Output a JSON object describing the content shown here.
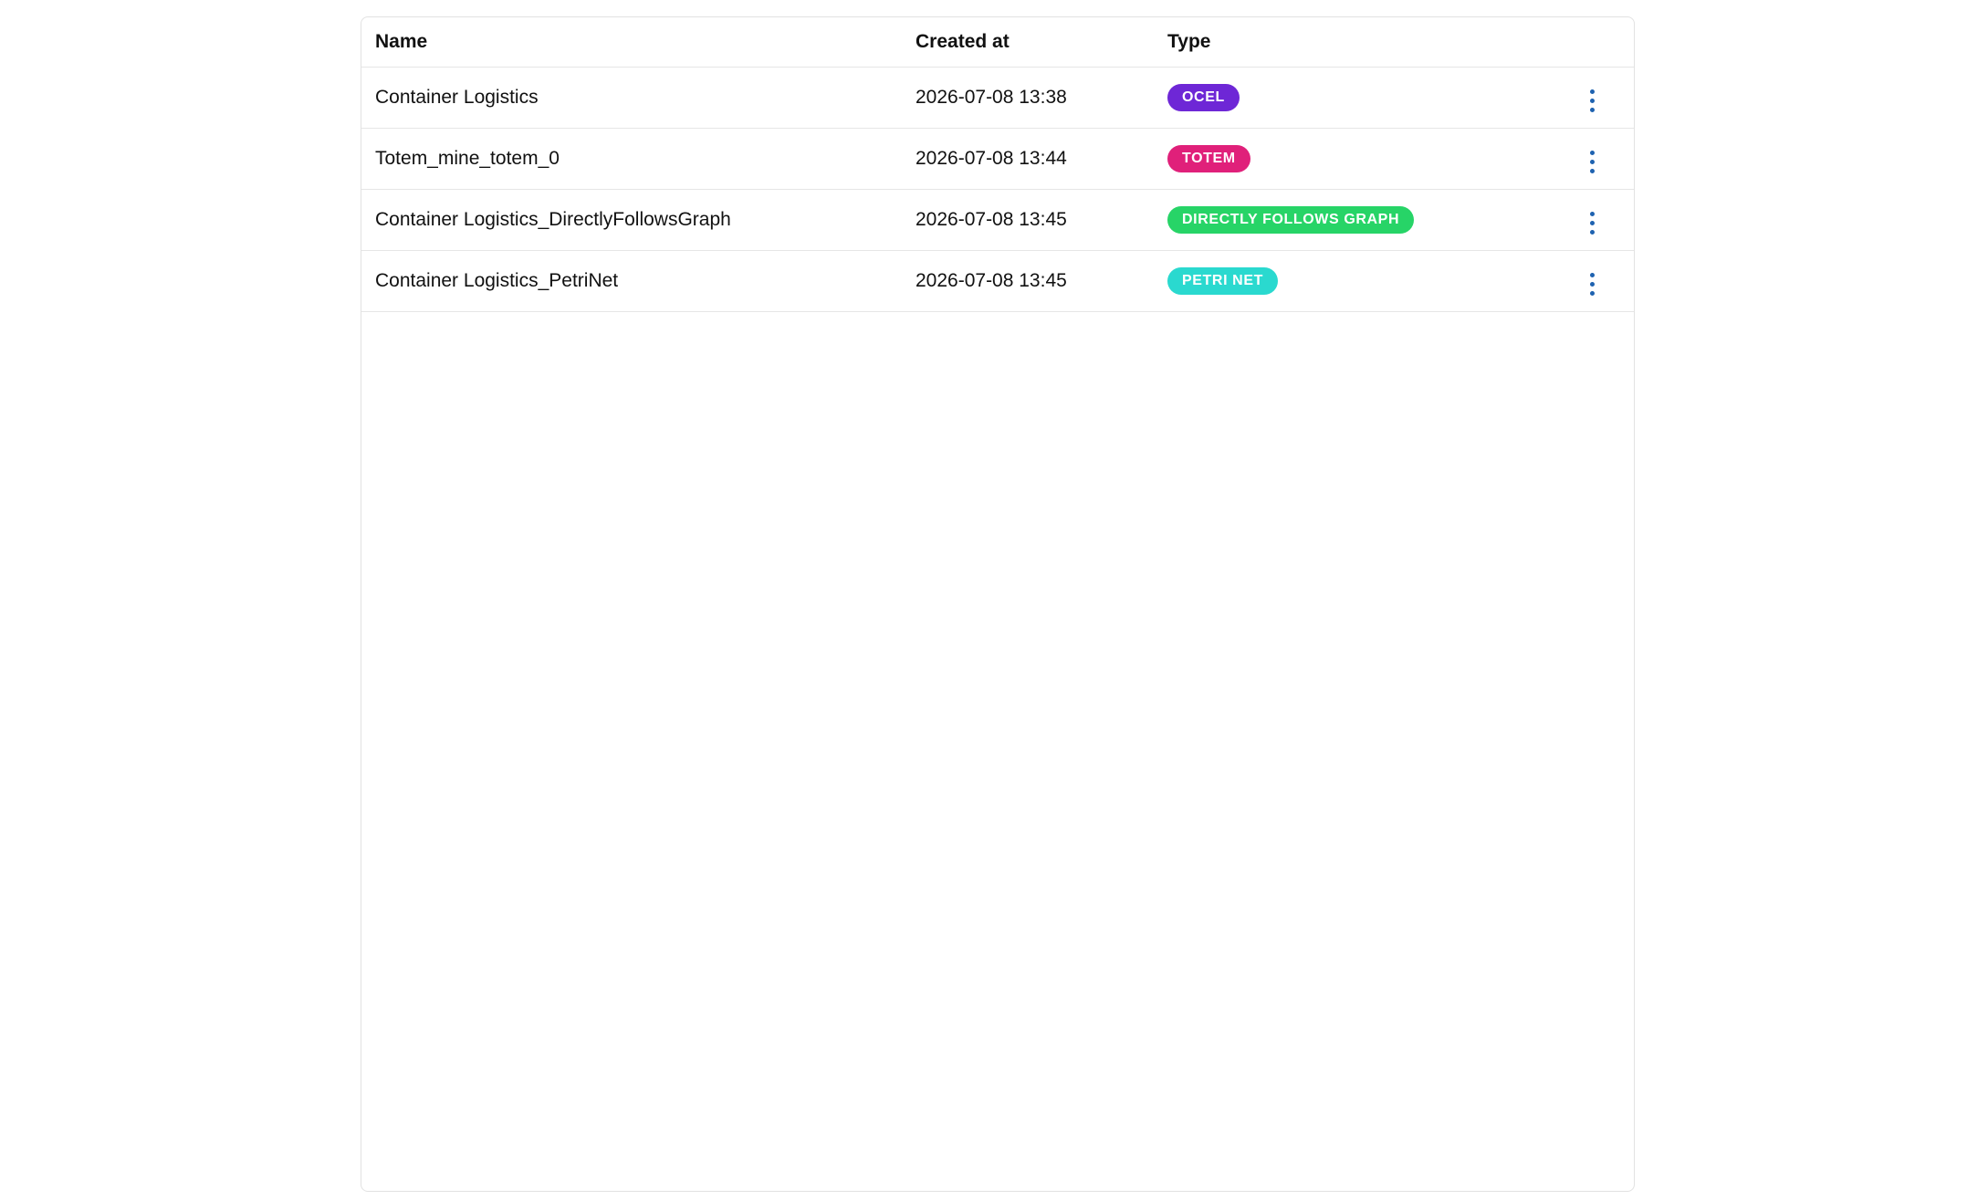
{
  "table": {
    "columns": {
      "name": "Name",
      "created_at": "Created at",
      "type": "Type"
    },
    "rows": [
      {
        "name": "Container Logistics",
        "created_at": "2026-07-08 13:38",
        "type": "OCEL",
        "type_color": "#6e27d6"
      },
      {
        "name": "Totem_mine_totem_0",
        "created_at": "2026-07-08 13:44",
        "type": "TOTEM",
        "type_color": "#e0207a"
      },
      {
        "name": "Container Logistics_DirectlyFollowsGraph",
        "created_at": "2026-07-08 13:45",
        "type": "DIRECTLY FOLLOWS GRAPH",
        "type_color": "#27d467"
      },
      {
        "name": "Container Logistics_PetriNet",
        "created_at": "2026-07-08 13:45",
        "type": "PETRI NET",
        "type_color": "#2ad9cf"
      }
    ],
    "row_action_icon": "kebab-menu-icon",
    "accent_color": "#1e62b0"
  }
}
